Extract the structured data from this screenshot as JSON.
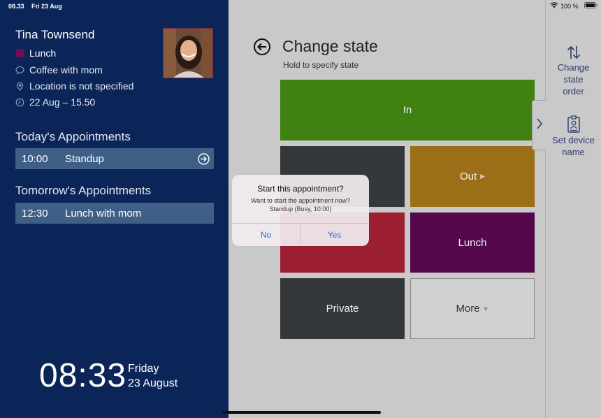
{
  "status_bar": {
    "time": "08.33",
    "date": "Fri 23 Aug",
    "battery": "100 %"
  },
  "person": {
    "name": "Tina Townsend",
    "state": "Lunch",
    "message": "Coffee with mom",
    "location": "Location is not specified",
    "until": "22 Aug – 15.50"
  },
  "today": {
    "title": "Today's Appointments",
    "items": [
      {
        "time": "10:00",
        "name": "Standup"
      }
    ]
  },
  "tomorrow": {
    "title": "Tomorrow's Appointments",
    "items": [
      {
        "time": "12:30",
        "name": "Lunch with mom"
      }
    ]
  },
  "clock": {
    "time": "08:33",
    "weekday": "Friday",
    "date": "23 August"
  },
  "main": {
    "title": "Change state",
    "subtitle": "Hold to specify state",
    "tiles": [
      {
        "label": "In",
        "color": "#3f8211"
      },
      {
        "label": "",
        "color": "#35383b"
      },
      {
        "label": "Out",
        "color": "#9b6f17"
      },
      {
        "label": "",
        "color": "#9c1e31"
      },
      {
        "label": "Lunch",
        "color": "#55084e"
      },
      {
        "label": "Private",
        "color": "#35383b"
      },
      {
        "label": "More",
        "color": "#d0d0d0"
      }
    ]
  },
  "side": {
    "change_order": "Change state order",
    "set_device": "Set device name"
  },
  "dialog": {
    "title": "Start this appointment?",
    "message_1": "Want to start the appointment now?",
    "message_2": "Standup (Busy, 10:00)",
    "no": "No",
    "yes": "Yes"
  },
  "colors": {
    "left_bg": "#0b2558",
    "accent": "#2f6dd6"
  }
}
